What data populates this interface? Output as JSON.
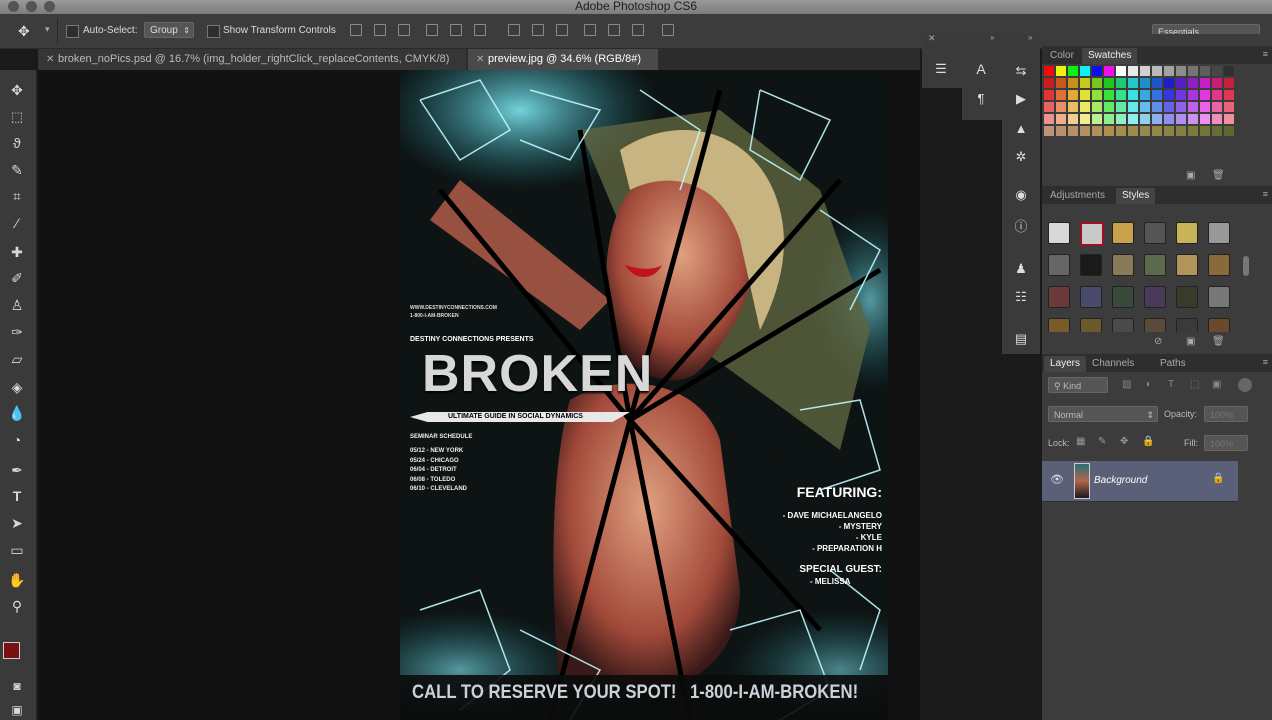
{
  "app": {
    "title": "Adobe Photoshop CS6",
    "workspace": "Essentials"
  },
  "options_bar": {
    "auto_select_label": "Auto-Select:",
    "auto_select_target": "Group",
    "transform_controls_label": "Show Transform Controls"
  },
  "documents": {
    "tabs": [
      {
        "label": "broken_noPics.psd @ 16.7% (img_holder_rightClick_replaceContents, CMYK/8)",
        "active": false
      },
      {
        "label": "preview.jpg @ 34.6% (RGB/8#)",
        "active": true
      }
    ]
  },
  "poster": {
    "website": "WWW.DESTINYCONNECTIONS.COM",
    "phone_small": "1-800-I-AM-BROKEN",
    "presents": "DESTINY CONNECTIONS PRESENTS",
    "title": "BROKEN",
    "subtitle": "ULTIMATE GUIDE IN SOCIAL DYNAMICS",
    "schedule_heading": "SEMINAR SCHEDULE",
    "schedule": [
      "05/12 - NEW YORK",
      "05/24 - CHICAGO",
      "06/04 - DETROIT",
      "06/08 - TOLEDO",
      "06/10 - CLEVELAND"
    ],
    "featuring_heading": "FEATURING:",
    "featuring": [
      "- DAVE MICHAELANGELO",
      "- MYSTERY",
      "- KYLE",
      "- PREPARATION H"
    ],
    "special_heading": "SPECIAL GUEST:",
    "special": "- MELISSA",
    "footer_cta": "CALL TO RESERVE YOUR SPOT!",
    "footer_phone": "1-800-I-AM-BROKEN!"
  },
  "panels": {
    "color_tabs": [
      "Color",
      "Swatches"
    ],
    "adjust_tabs": [
      "Adjustments",
      "Styles"
    ],
    "layers_tabs": [
      "Layers",
      "Channels",
      "Paths"
    ],
    "kind_label": "Kind",
    "blend_mode": "Normal",
    "opacity_label": "Opacity:",
    "opacity_value": "100%",
    "lock_label": "Lock:",
    "fill_label": "Fill:",
    "fill_value": "100%",
    "layer_name": "Background"
  },
  "colors": {
    "foreground": "#7a1010",
    "background": "#ffffff",
    "accent_cyan": "#38d6e6"
  }
}
